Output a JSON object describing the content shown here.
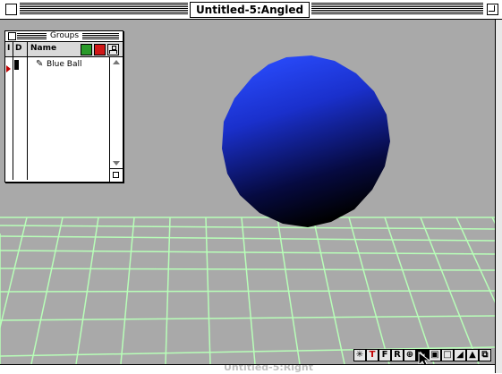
{
  "window": {
    "title": "Untitled-5:Angled"
  },
  "viewport": {
    "object_name": "Blue Ball",
    "sphere_color": "#1e3cff",
    "grid_color": "#b8ffb8",
    "background_color": "#a9a9a9"
  },
  "groups_palette": {
    "title": "Groups",
    "col_i": "I",
    "col_d": "D",
    "col_name": "Name",
    "items": [
      {
        "label": "Blue Ball",
        "icon": "pencil-icon"
      }
    ]
  },
  "toolbar": {
    "tools": [
      {
        "name": "light-tool",
        "glyph": "✳"
      },
      {
        "name": "text-tool",
        "glyph": "T"
      },
      {
        "name": "frame-tool",
        "glyph": "F"
      },
      {
        "name": "render-tool",
        "glyph": "R"
      },
      {
        "name": "globe-tool",
        "glyph": "⊕"
      },
      {
        "name": "arrow-tool",
        "glyph": "➘"
      },
      {
        "name": "image-tool",
        "glyph": "▣"
      },
      {
        "name": "square-tool",
        "glyph": "□"
      },
      {
        "name": "shade-tool",
        "glyph": "◢"
      },
      {
        "name": "terrain-tool",
        "glyph": "▲"
      },
      {
        "name": "resize-tool",
        "glyph": "⧉"
      }
    ]
  },
  "status": {
    "ghost_title": "Untitled-5:Right"
  }
}
